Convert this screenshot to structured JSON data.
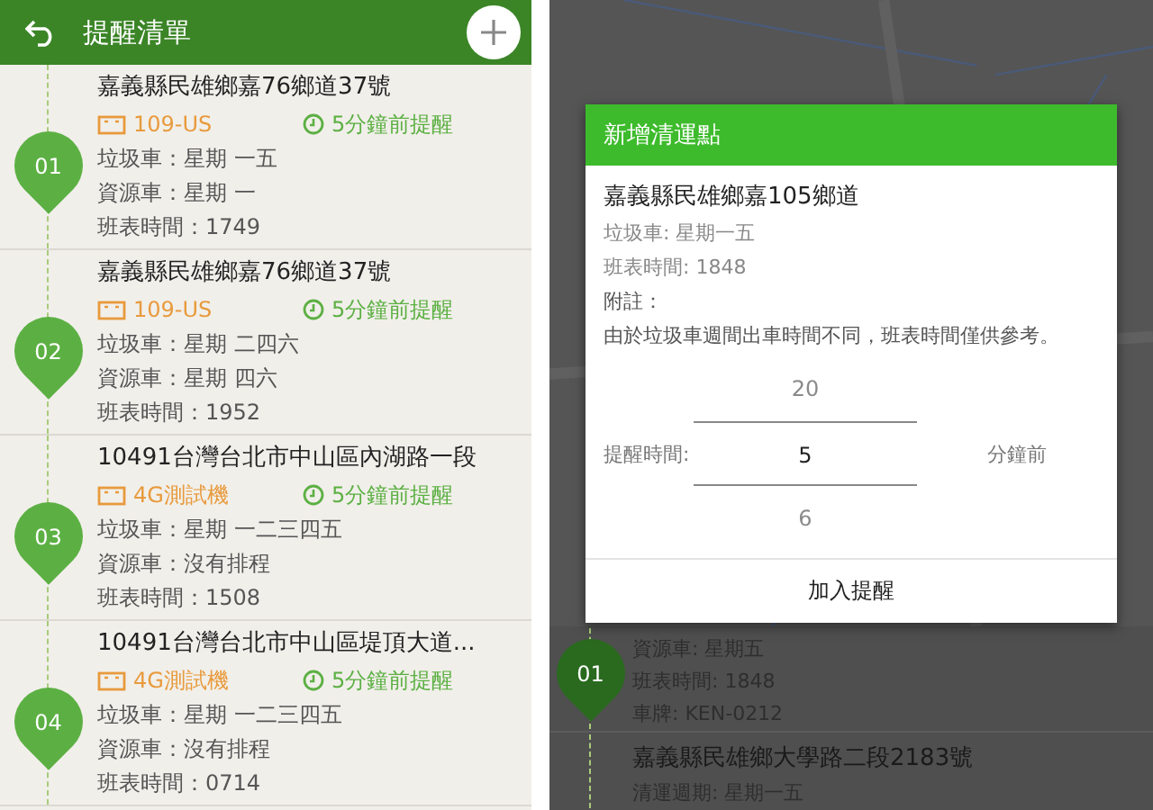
{
  "reminder_list": {
    "title": "提醒清單",
    "items": [
      {
        "pin": "01",
        "address": "嘉義縣民雄鄉嘉76鄉道37號",
        "device": "109-US",
        "reminder": "5分鐘前提醒",
        "lines": [
          "垃圾車：星期 一五",
          "資源車：星期 一",
          "班表時間：1749"
        ]
      },
      {
        "pin": "02",
        "address": "嘉義縣民雄鄉嘉76鄉道37號",
        "device": "109-US",
        "reminder": "5分鐘前提醒",
        "lines": [
          "垃圾車：星期 二四六",
          "資源車：星期 四六",
          "班表時間：1952"
        ]
      },
      {
        "pin": "03",
        "address": "10491台灣台北市中山區內湖路一段",
        "device": "4G測試機",
        "reminder": "5分鐘前提醒",
        "lines": [
          "垃圾車：星期 一二三四五",
          "資源車：沒有排程",
          "班表時間：1508"
        ]
      },
      {
        "pin": "04",
        "address": "10491台灣台北市中山區堤頂大道...",
        "device": "4G測試機",
        "reminder": "5分鐘前提醒",
        "lines": [
          "垃圾車：星期 一二三四五",
          "資源車：沒有排程",
          "班表時間：0714"
        ]
      }
    ]
  },
  "background_list": {
    "items": [
      {
        "pin": "01",
        "lines": [
          "資源車: 星期五",
          "班表時間: 1848",
          "車牌: KEN-0212"
        ]
      },
      {
        "title": "嘉義縣民雄鄉大學路二段2183號",
        "lines": [
          "清運週期: 星期一五"
        ]
      }
    ]
  },
  "dialog": {
    "title": "新增清運點",
    "address": "嘉義縣民雄鄉嘉105鄉道",
    "lines": [
      "垃圾車: 星期一五",
      "班表時間: 1848"
    ],
    "note_label": "附註：",
    "note": "由於垃圾車週間出車時間不同，班表時間僅供參考。",
    "picker": {
      "label": "提醒時間:",
      "unit": "分鐘前",
      "options": [
        {
          "value": "20",
          "selected": false
        },
        {
          "value": "5",
          "selected": true
        },
        {
          "value": "6",
          "selected": false
        }
      ]
    },
    "button": "加入提醒"
  }
}
